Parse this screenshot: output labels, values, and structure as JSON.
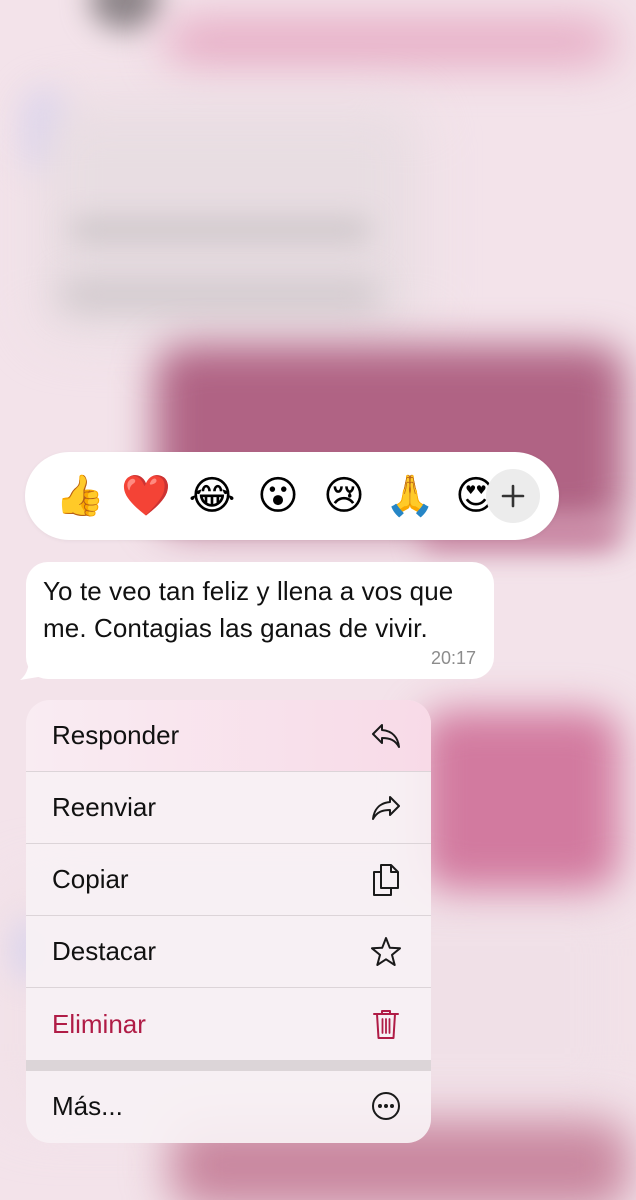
{
  "reactions": {
    "emojis": [
      "👍",
      "❤️",
      "😂",
      "😮",
      "😢",
      "🙏",
      "😍"
    ],
    "more_button": "+"
  },
  "message": {
    "text": "Yo te veo tan feliz y llena a vos que me. Contagias las ganas de vivir.",
    "time": "20:17"
  },
  "menu": {
    "items": [
      {
        "label": "Responder",
        "icon": "reply-icon"
      },
      {
        "label": "Reenviar",
        "icon": "forward-icon"
      },
      {
        "label": "Copiar",
        "icon": "copy-icon"
      },
      {
        "label": "Destacar",
        "icon": "star-icon"
      },
      {
        "label": "Eliminar",
        "icon": "trash-icon"
      },
      {
        "label": "Más...",
        "icon": "more-circle-icon"
      }
    ]
  },
  "colors": {
    "danger": "#b01c46",
    "bubble": "#ffffff",
    "time": "#8c8c8c"
  }
}
